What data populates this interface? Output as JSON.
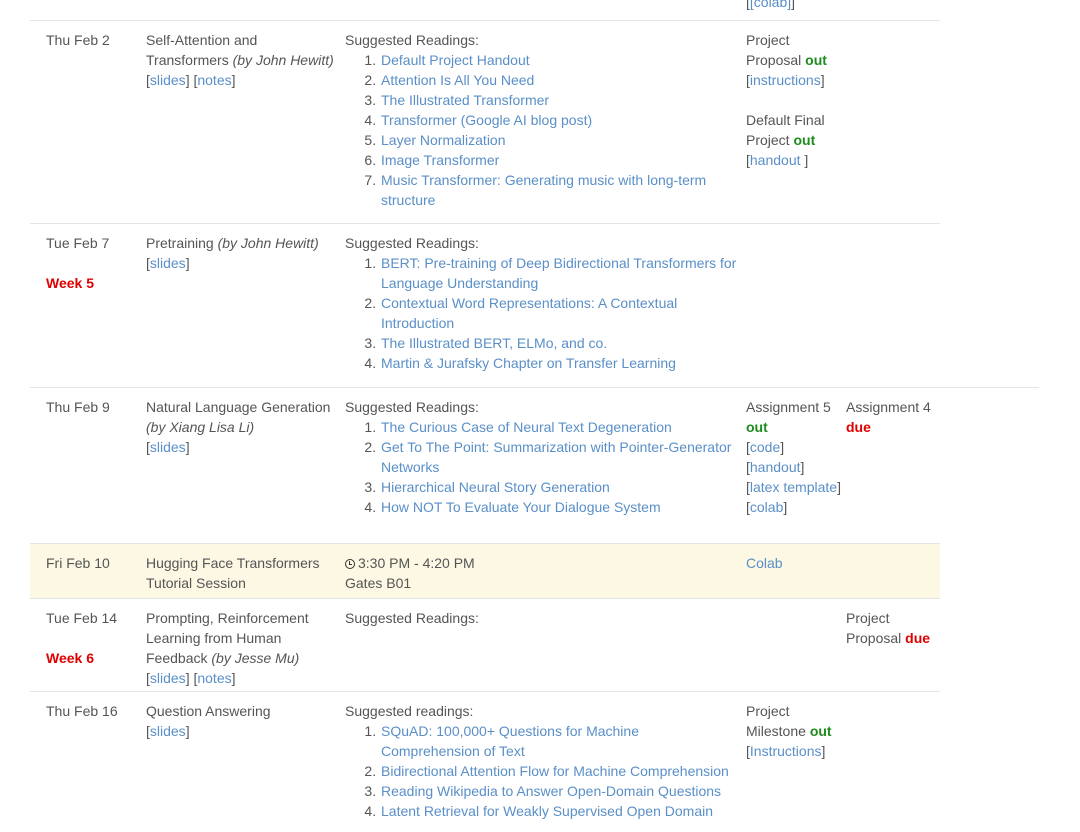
{
  "top_partial": {
    "link": "[colab]"
  },
  "rows": [
    {
      "date": "Thu Feb 2",
      "title": "Self-Attention and Transformers",
      "speaker": "(by John Hewitt)",
      "links": [
        "slides",
        "notes"
      ],
      "readings_label": "Suggested Readings:",
      "readings": [
        "Default Project Handout",
        "Attention Is All You Need",
        "The Illustrated Transformer",
        "Transformer (Google AI blog post)",
        "Layer Normalization",
        "Image Transformer",
        "Music Transformer: Generating music with long-term structure"
      ],
      "release": {
        "a_line1": "Project",
        "a_line2": "Proposal",
        "a_status": "out",
        "a_link": "instructions",
        "b_line1": "Default Final",
        "b_line2": "Project",
        "b_status": "out",
        "b_link": "handout "
      }
    },
    {
      "date": "Tue Feb 7",
      "week": "Week 5",
      "title": "Pretraining",
      "speaker": "(by John Hewitt)",
      "links": [
        "slides"
      ],
      "readings_label": "Suggested Readings:",
      "readings": [
        "BERT: Pre-training of Deep Bidirectional Transformers for Language Understanding",
        "Contextual Word Representations: A Contextual Introduction",
        "The Illustrated BERT, ELMo, and co.",
        "Martin & Jurafsky Chapter on Transfer Learning"
      ]
    },
    {
      "date": "Thu Feb 9",
      "title": "Natural Language Generation",
      "speaker": "(by Xiang Lisa Li)",
      "links": [
        "slides"
      ],
      "readings_label": "Suggested Readings:",
      "readings": [
        "The Curious Case of Neural Text Degeneration",
        "Get To The Point: Summarization with Pointer-Generator Networks",
        "Hierarchical Neural Story Generation",
        "How NOT To Evaluate Your Dialogue System"
      ],
      "release": {
        "line1": "Assignment 5",
        "status": "out",
        "links": [
          "code",
          "handout",
          "latex template",
          "colab"
        ]
      },
      "deadline": {
        "line1": "Assignment 4",
        "status": "due"
      }
    },
    {
      "date": "Fri Feb 10",
      "title": "Hugging Face Transformers Tutorial Session",
      "time": "3:30 PM - 4:20 PM",
      "location": "Gates B01",
      "material": "Colab"
    },
    {
      "date": "Tue Feb 14",
      "week": "Week 6",
      "title": "Prompting, Reinforcement Learning from Human Feedback",
      "speaker": "(by Jesse Mu)",
      "links": [
        "slides",
        "notes"
      ],
      "readings_label": "Suggested Readings:",
      "deadline": {
        "line1": "Project",
        "line2": "Proposal",
        "status": "due"
      }
    },
    {
      "date": "Thu Feb 16",
      "title": "Question Answering",
      "links": [
        "slides"
      ],
      "readings_label": "Suggested readings:",
      "readings": [
        "SQuAD: 100,000+ Questions for Machine Comprehension of Text",
        "Bidirectional Attention Flow for Machine Comprehension",
        "Reading Wikipedia to Answer Open-Domain Questions",
        "Latent Retrieval for Weakly Supervised Open Domain"
      ],
      "release": {
        "line1": "Project",
        "line2": "Milestone",
        "status": "out",
        "link": "Instructions"
      }
    }
  ]
}
